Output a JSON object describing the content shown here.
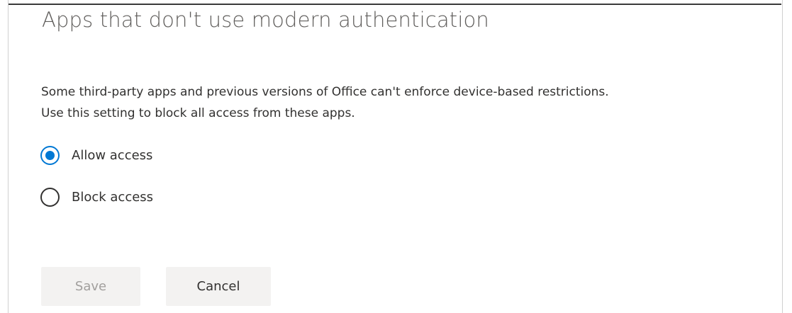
{
  "panel": {
    "title": "Apps that don't use modern authentication",
    "description_lines": [
      "Some third-party apps and previous versions of Office can't enforce device-based restrictions.",
      "Use this setting to block all access from these apps."
    ],
    "options": [
      {
        "label": "Allow access",
        "selected": true
      },
      {
        "label": "Block access",
        "selected": false
      }
    ]
  },
  "buttons": {
    "save_label": "Save",
    "save_enabled": false,
    "cancel_label": "Cancel"
  },
  "colors": {
    "accent": "#0078d4",
    "title_text": "#605e5c",
    "body_text": "#323130",
    "button_bg": "#f3f2f1",
    "disabled_text": "#a19f9d"
  }
}
